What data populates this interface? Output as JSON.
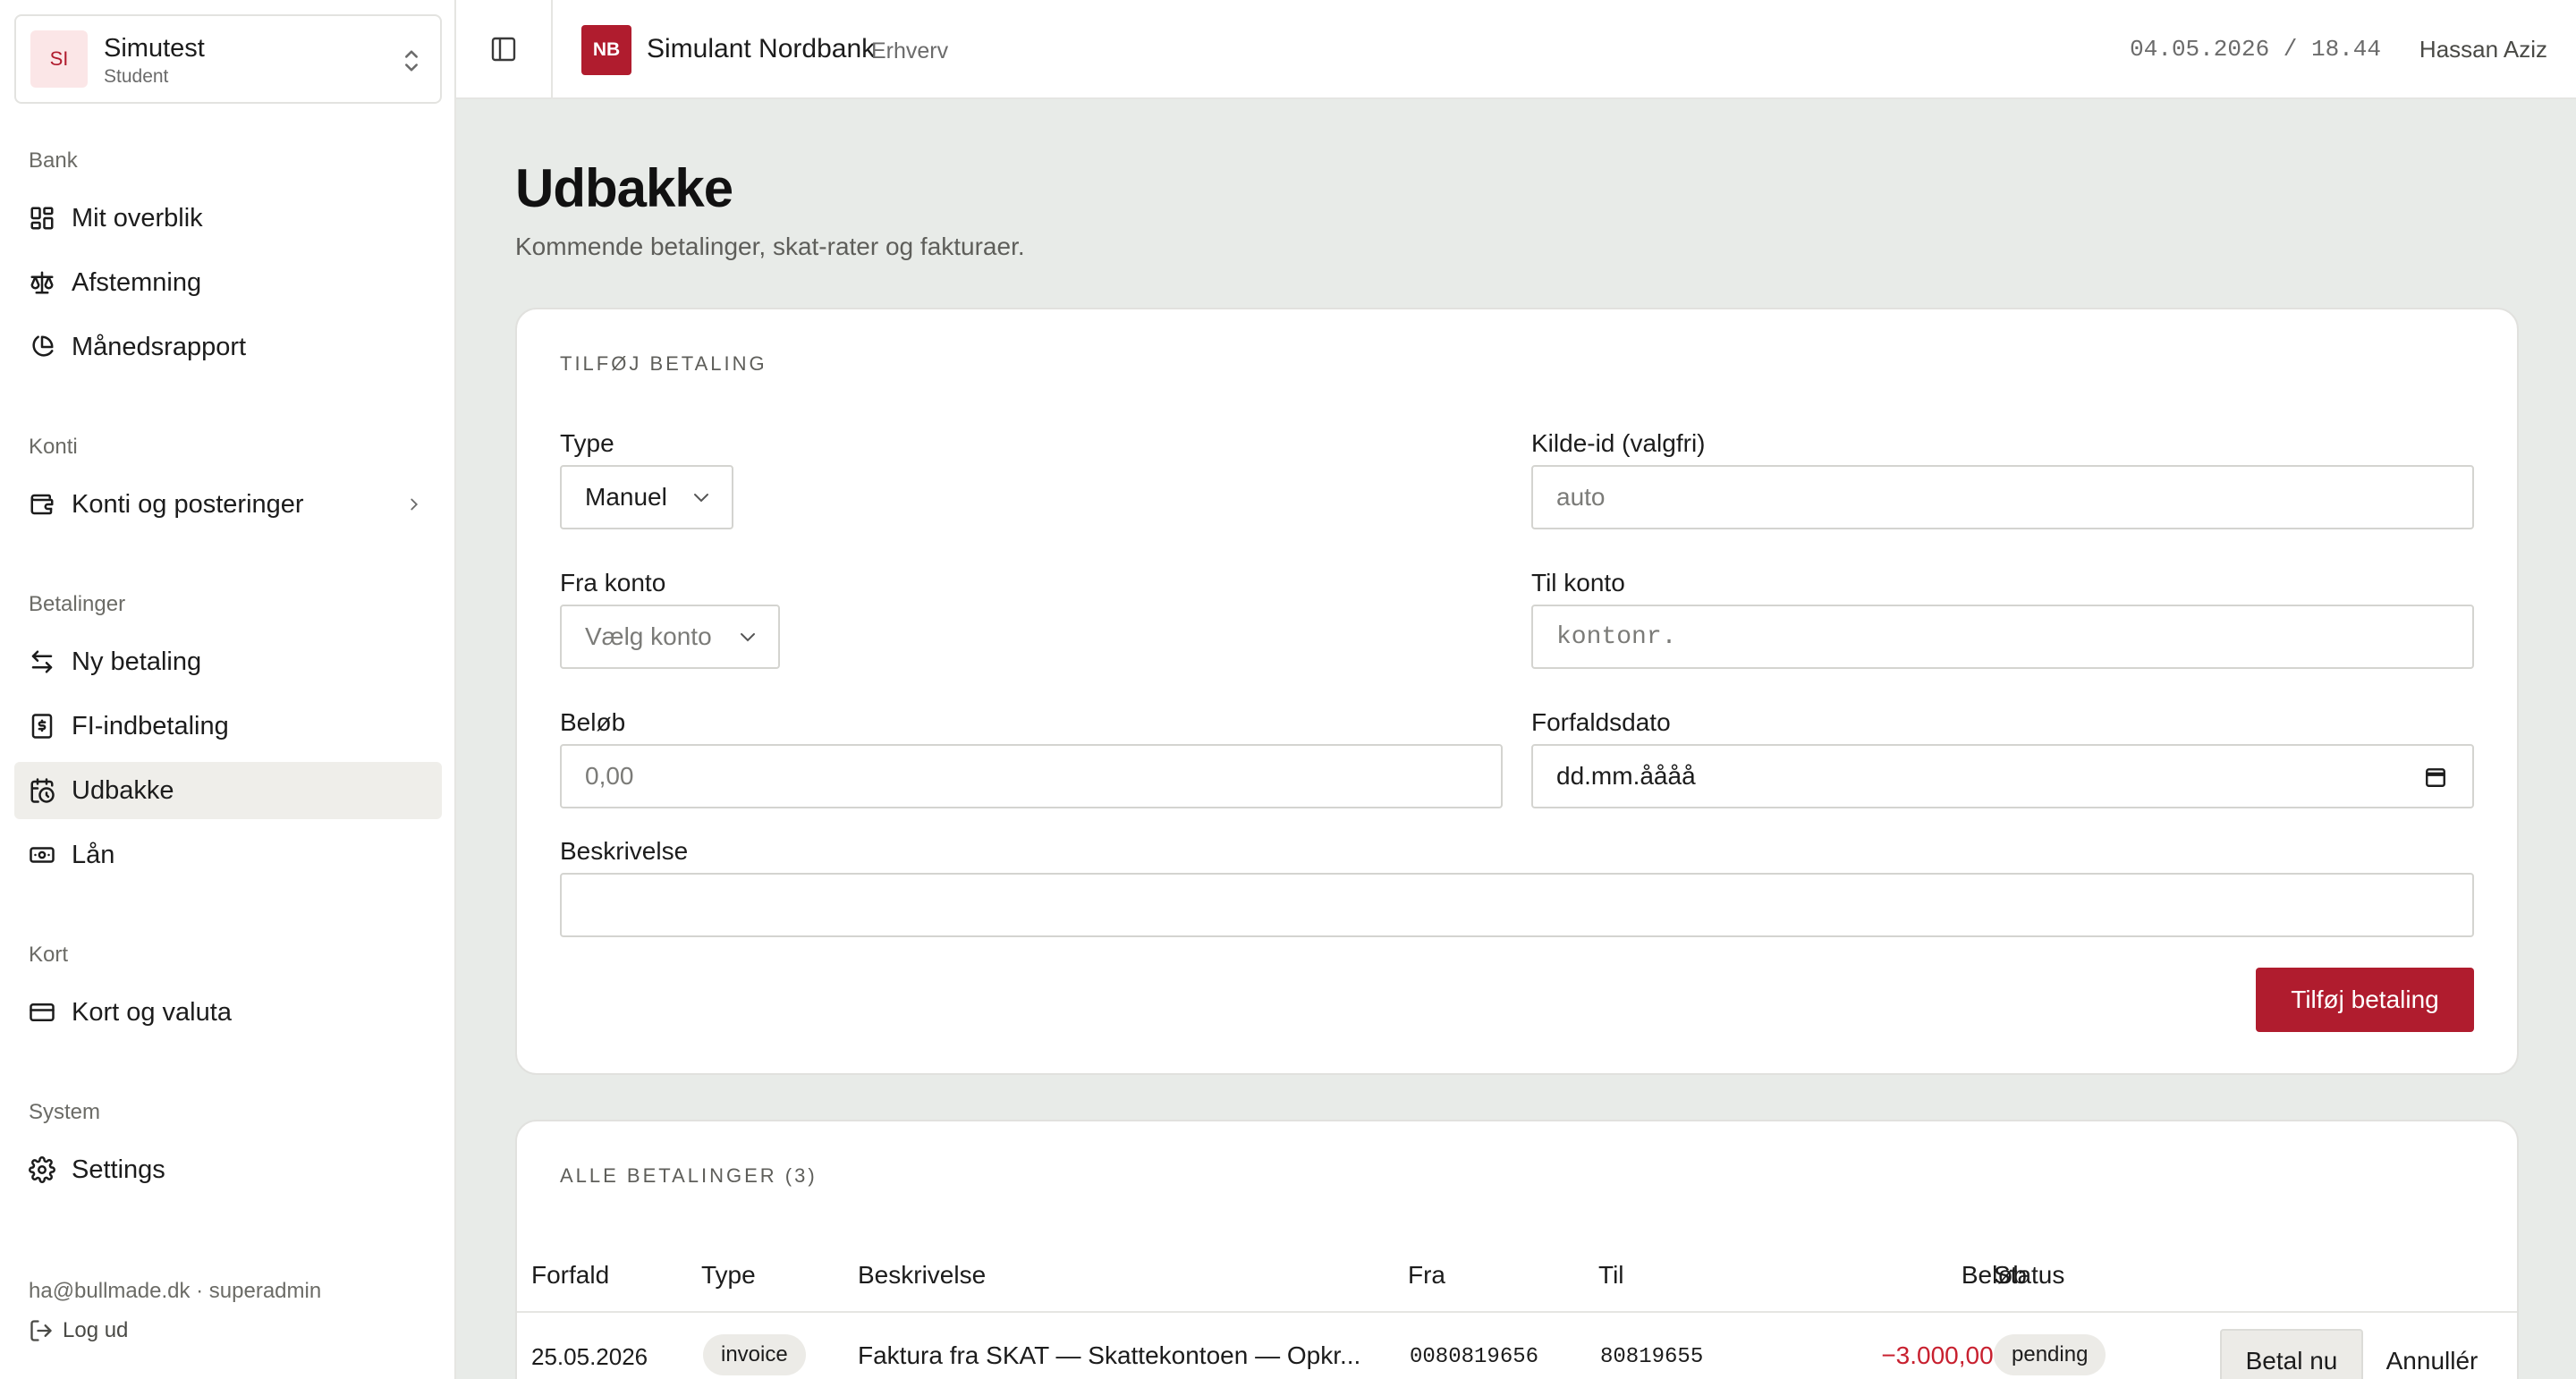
{
  "org": {
    "initials": "SI",
    "name": "Simutest",
    "role": "Student"
  },
  "topbar": {
    "bank_initials": "NB",
    "bank_name": "Simulant Nordbank",
    "segment": "Erhverv",
    "datetime": "04.05.2026 / 18.44",
    "user": "Hassan Aziz"
  },
  "nav": {
    "bank_label": "Bank",
    "overview": "Mit overblik",
    "reconciliation": "Afstemning",
    "monthly_report": "Månedsrapport",
    "accounts_label": "Konti",
    "accounts": "Konti og posteringer",
    "payments_label": "Betalinger",
    "new_payment": "Ny betaling",
    "fi_payment": "FI-indbetaling",
    "outbox": "Udbakke",
    "loans": "Lån",
    "cards_label": "Kort",
    "cards": "Kort og valuta",
    "system_label": "System",
    "settings": "Settings"
  },
  "footer": {
    "email": "ha@bullmade.dk · superadmin",
    "logout": "Log ud"
  },
  "page": {
    "title": "Udbakke",
    "subtitle": "Kommende betalinger, skat-rater og fakturaer."
  },
  "form": {
    "section": "TILFØJ BETALING",
    "type_label": "Type",
    "type_value": "Manuel",
    "source_label": "Kilde-id (valgfri)",
    "source_placeholder": "auto",
    "from_label": "Fra konto",
    "from_placeholder": "Vælg konto",
    "to_label": "Til konto",
    "to_placeholder": "kontonr.",
    "amount_label": "Beløb",
    "amount_placeholder": "0,00",
    "due_label": "Forfaldsdato",
    "due_placeholder": "dd.mm.åååå",
    "desc_label": "Beskrivelse",
    "desc_value": "",
    "submit": "Tilføj betaling"
  },
  "table": {
    "section": "ALLE BETALINGER (3)",
    "headers": {
      "due": "Forfald",
      "type": "Type",
      "desc": "Beskrivelse",
      "from": "Fra",
      "to": "Til",
      "amount": "Beløb",
      "status": "Status"
    },
    "rows": [
      {
        "due": "25.05.2026",
        "type": "invoice",
        "desc": "Faktura fra SKAT — Skattekontoen — Opkr...",
        "from": "0080819656",
        "to": "80819655",
        "amount": "−3.000,00 kr.",
        "status": "pending",
        "pay": "Betal nu",
        "cancel": "Annullér"
      }
    ]
  },
  "colors": {
    "accent": "#b01c2e",
    "negative": "#c8202f",
    "background": "#e8ebe8"
  }
}
